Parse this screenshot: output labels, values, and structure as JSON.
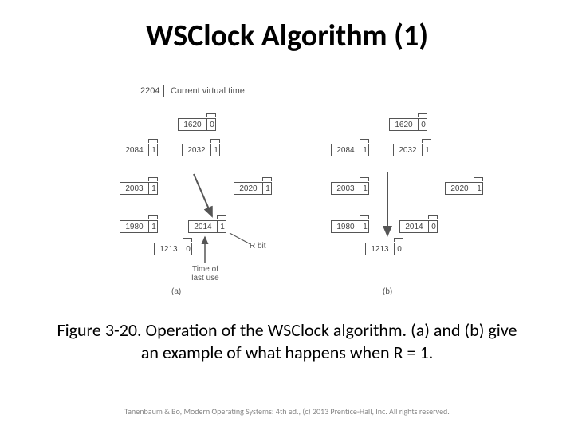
{
  "title": "WSClock Algorithm (1)",
  "cvt_value": "2204",
  "cvt_label": "Current virtual time",
  "labels": {
    "rbit": "R bit",
    "time_of_last_use": "Time of\nlast use",
    "a": "(a)",
    "b": "(b)"
  },
  "diagram_a": {
    "pages": [
      {
        "time": "1620",
        "r": "0"
      },
      {
        "time": "2084",
        "r": "1"
      },
      {
        "time": "2032",
        "r": "1"
      },
      {
        "time": "2003",
        "r": "1"
      },
      {
        "time": "2020",
        "r": "1"
      },
      {
        "time": "1980",
        "r": "1"
      },
      {
        "time": "2014",
        "r": "1"
      },
      {
        "time": "1213",
        "r": "0"
      }
    ]
  },
  "diagram_b": {
    "pages": [
      {
        "time": "1620",
        "r": "0"
      },
      {
        "time": "2084",
        "r": "1"
      },
      {
        "time": "2032",
        "r": "1"
      },
      {
        "time": "2003",
        "r": "1"
      },
      {
        "time": "2020",
        "r": "1"
      },
      {
        "time": "1980",
        "r": "1"
      },
      {
        "time": "2014",
        "r": "0"
      },
      {
        "time": "1213",
        "r": "0"
      }
    ]
  },
  "caption": "Figure 3-20. Operation of the WSClock algorithm. (a) and (b) give an example of what happens when R = 1.",
  "footer": "Tanenbaum & Bo, Modern Operating Systems: 4th ed., (c) 2013 Prentice-Hall, Inc. All rights reserved."
}
